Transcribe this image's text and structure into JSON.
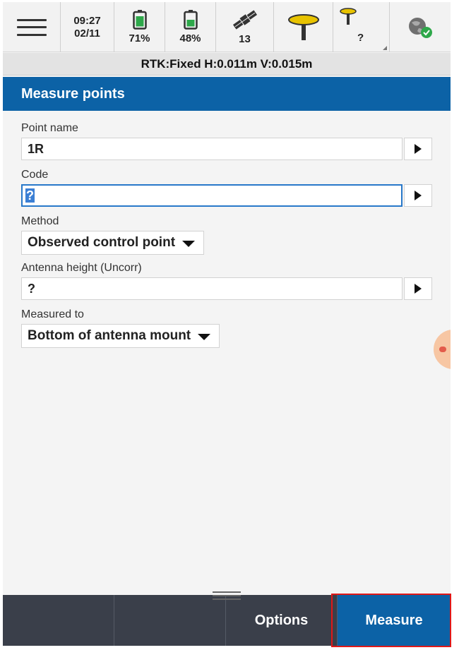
{
  "status": {
    "time": "09:27",
    "date": "02/11",
    "battery1": "71%",
    "battery2": "48%",
    "satellites": "13",
    "antenna2": "?"
  },
  "rtk_line": "RTK:Fixed H:0.011m V:0.015m",
  "title": "Measure points",
  "form": {
    "point_name_label": "Point name",
    "point_name_value": "1R",
    "code_label": "Code",
    "code_value": "?",
    "method_label": "Method",
    "method_value": "Observed control point",
    "antenna_height_label": "Antenna height (Uncorr)",
    "antenna_height_value": "?",
    "measured_to_label": "Measured to",
    "measured_to_value": "Bottom of antenna mount"
  },
  "bottom": {
    "options_label": "Options",
    "measure_label": "Measure"
  },
  "colors": {
    "accent": "#0c62a6",
    "bottom_bar": "#3a3f4a",
    "highlight": "#e01818"
  }
}
